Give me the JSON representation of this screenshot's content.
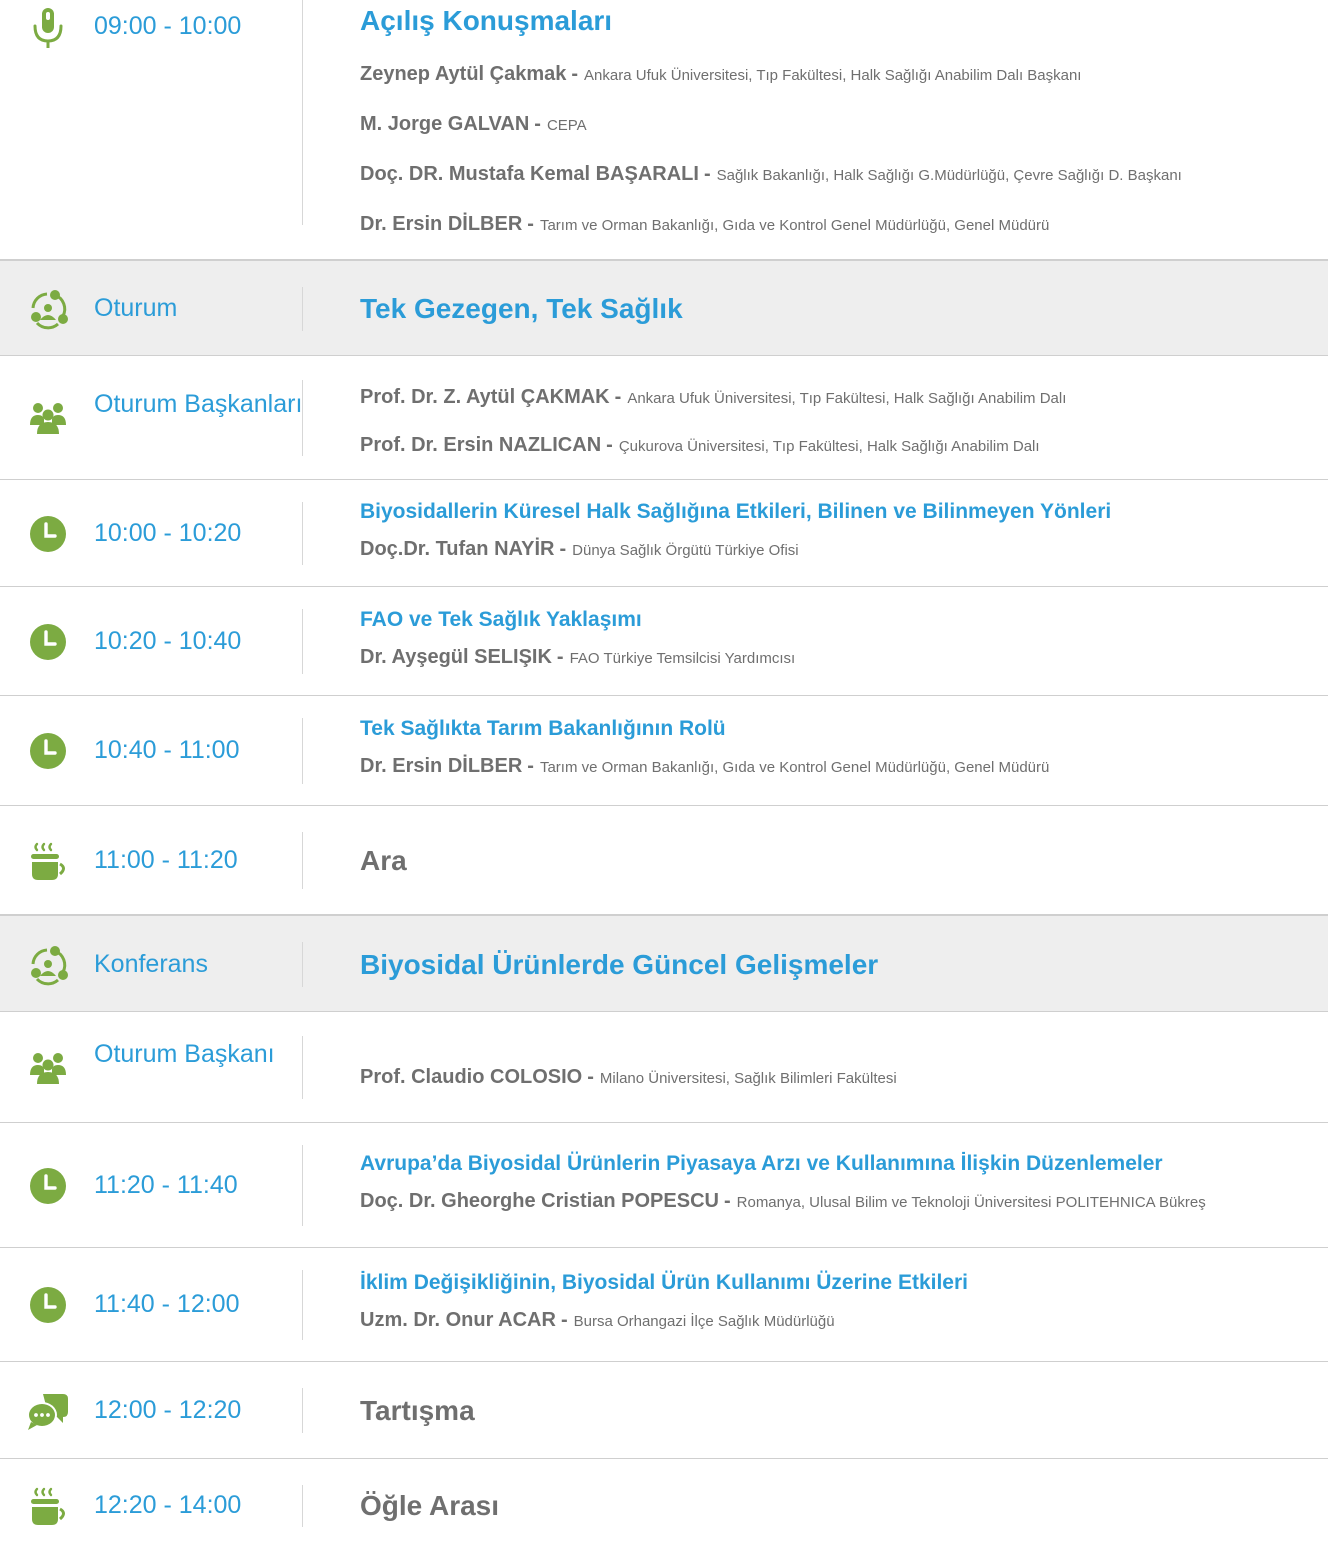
{
  "rows": [
    {
      "kind": "talk",
      "icon": "microphone-icon",
      "time": "09:00 - 10:00",
      "title": "Açılış Konuşmaları",
      "speakers": [
        {
          "name": "Zeynep Aytül Çakmak",
          "affiliation": "Ankara Ufuk Üniversitesi, Tıp Fakültesi, Halk Sağlığı Anabilim Dalı Başkanı"
        },
        {
          "name": "M. Jorge GALVAN",
          "affiliation": "CEPA"
        },
        {
          "name": "Doç. DR. Mustafa Kemal BAŞARALI",
          "affiliation": "Sağlık Bakanlığı, Halk Sağlığı G.Müdürlüğü, Çevre Sağlığı D. Başkanı"
        },
        {
          "name": "Dr. Ersin DİLBER",
          "affiliation": "Tarım ve Orman Bakanlığı, Gıda ve Kontrol Genel Müdürlüğü, Genel Müdürü"
        }
      ]
    },
    {
      "kind": "session",
      "icon": "session-icon",
      "time": "Oturum",
      "title": "Tek Gezegen, Tek Sağlık"
    },
    {
      "kind": "chairs",
      "icon": "people-icon",
      "time": "Oturum Başkanları",
      "speakers": [
        {
          "name": "Prof. Dr. Z. Aytül ÇAKMAK",
          "affiliation": "Ankara Ufuk Üniversitesi, Tıp Fakültesi, Halk Sağlığı Anabilim Dalı"
        },
        {
          "name": "Prof. Dr. Ersin NAZLICAN",
          "affiliation": "Çukurova Üniversitesi, Tıp Fakültesi, Halk Sağlığı Anabilim Dalı"
        }
      ]
    },
    {
      "kind": "talk",
      "icon": "clock-icon",
      "time": "10:00 - 10:20",
      "title": "Biyosidallerin Küresel Halk Sağlığına Etkileri, Bilinen ve Bilinmeyen Yönleri",
      "speakers": [
        {
          "name": "Doç.Dr. Tufan NAYİR",
          "affiliation": "Dünya Sağlık Örgütü Türkiye Ofisi"
        }
      ]
    },
    {
      "kind": "talk",
      "icon": "clock-icon",
      "time": "10:20 - 10:40",
      "title": "FAO ve Tek Sağlık Yaklaşımı",
      "speakers": [
        {
          "name": "Dr. Ayşegül SELIŞIK",
          "affiliation": "FAO Türkiye Temsilcisi Yardımcısı"
        }
      ]
    },
    {
      "kind": "talk",
      "icon": "clock-icon",
      "time": "10:40 - 11:00",
      "title": "Tek Sağlıkta Tarım Bakanlığının Rolü",
      "speakers": [
        {
          "name": "Dr. Ersin DİLBER",
          "affiliation": "Tarım ve Orman Bakanlığı, Gıda ve Kontrol Genel Müdürlüğü, Genel Müdürü"
        }
      ]
    },
    {
      "kind": "break",
      "icon": "coffee-icon",
      "time": "11:00 - 11:20",
      "title": "Ara"
    },
    {
      "kind": "session",
      "icon": "session-icon",
      "time": "Konferans",
      "title": "Biyosidal Ürünlerde Güncel Gelişmeler"
    },
    {
      "kind": "chairs",
      "icon": "people-icon",
      "time": "Oturum Başkanı",
      "speakers": [
        {
          "name": "Prof. Claudio COLOSIO",
          "affiliation": "Milano Üniversitesi, Sağlık Bilimleri Fakültesi"
        }
      ]
    },
    {
      "kind": "talk",
      "icon": "clock-icon",
      "time": "11:20 - 11:40",
      "title": "Avrupa’da Biyosidal Ürünlerin Piyasaya Arzı ve Kullanımına İlişkin Düzenlemeler",
      "speakers": [
        {
          "name": "Doç. Dr. Gheorghe Cristian POPESCU",
          "affiliation": "Romanya, Ulusal Bilim ve Teknoloji Üniversitesi POLITEHNICA Bükreş"
        }
      ]
    },
    {
      "kind": "talk",
      "icon": "clock-icon",
      "time": "11:40 - 12:00",
      "title": "İklim Değişikliğinin, Biyosidal Ürün Kullanımı Üzerine Etkileri",
      "speakers": [
        {
          "name": "Uzm. Dr. Onur ACAR",
          "affiliation": "Bursa Orhangazi İlçe Sağlık Müdürlüğü"
        }
      ]
    },
    {
      "kind": "break",
      "icon": "discussion-icon",
      "time": "12:00 - 12:20",
      "title": "Tartışma"
    },
    {
      "kind": "break",
      "icon": "coffee-icon",
      "time": "12:20 - 14:00",
      "title": "Öğle Arası"
    }
  ],
  "colors": {
    "accent_blue": "#2b9cd8",
    "icon_green": "#7cab42",
    "text_grey": "#6f6f6f",
    "shade": "#eeeeee"
  }
}
